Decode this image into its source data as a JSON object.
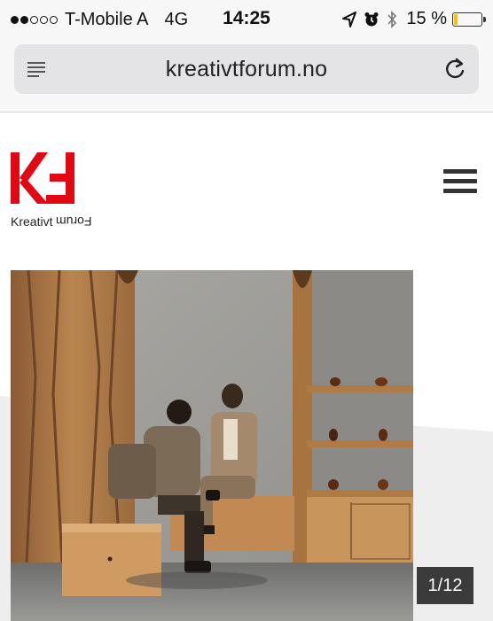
{
  "status_bar": {
    "signal_bars": 2,
    "signal_total": 5,
    "carrier": "T-Mobile A",
    "network": "4G",
    "time": "14:25",
    "battery_text": "15 %",
    "battery_level": 0.15,
    "battery_color": "#f5c400",
    "icons": [
      "location-arrow-icon",
      "alarm-clock-icon",
      "bluetooth-icon"
    ]
  },
  "browser": {
    "url": "kreativtforum.no",
    "icons": [
      "reader-view-icon",
      "reload-icon"
    ]
  },
  "site": {
    "logo_alt": "KF logo",
    "logo_color": "#e30613",
    "logo_caption_left": "Kreativt",
    "logo_caption_right": "Forum",
    "menu_icon": "hamburger-menu-icon"
  },
  "gallery": {
    "counter": "1/12"
  }
}
